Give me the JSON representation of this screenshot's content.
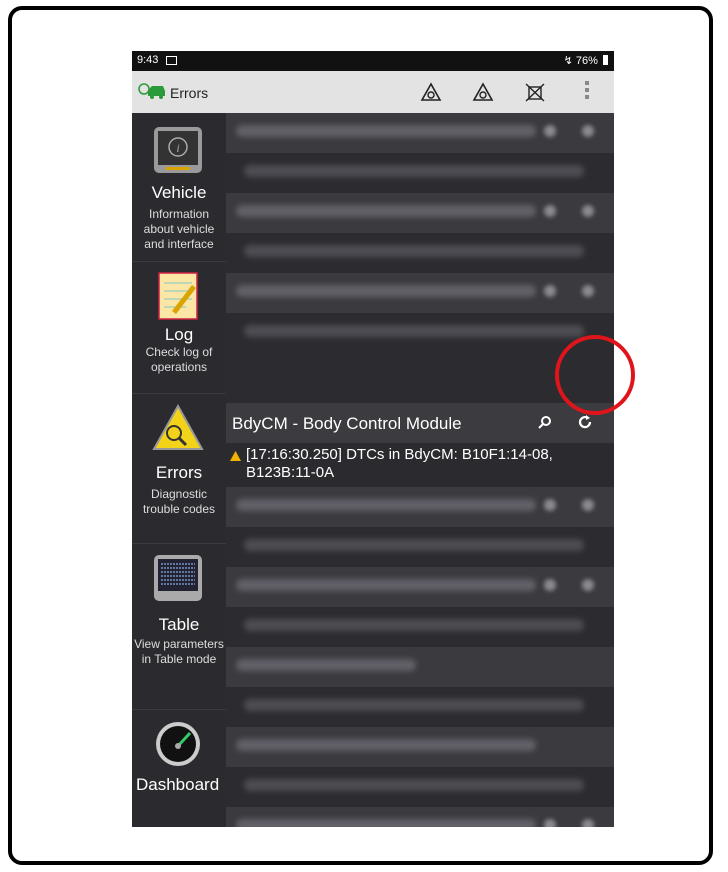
{
  "status": {
    "time": "9:43",
    "battery": "76%"
  },
  "appbar": {
    "title": "Errors"
  },
  "sidebar": {
    "items": [
      {
        "label": "Vehicle",
        "desc": "Information about vehicle and interface"
      },
      {
        "label": "Log",
        "desc": "Check log of operations"
      },
      {
        "label": "Errors",
        "desc": "Diagnostic trouble codes"
      },
      {
        "label": "Table",
        "desc": "View parameters in Table mode"
      },
      {
        "label": "Dashboard",
        "desc": ""
      }
    ]
  },
  "main": {
    "active_module": "BdyCM - Body Control Module",
    "active_message": "[17:16:30.250] DTCs in BdyCM: B10F1:14-08, B123B:11-0A"
  },
  "colors": {
    "accent_highlight": "#e0151b",
    "warning": "#f0b400"
  }
}
